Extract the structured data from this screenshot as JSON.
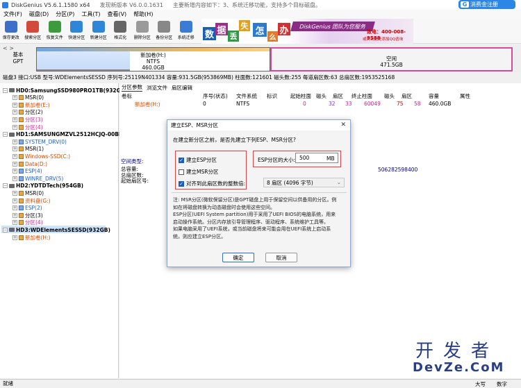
{
  "titlebar": {
    "app": "DiskGenius V5.6.1.1580 x64",
    "update": "发现新版本 V6.0.0.1631",
    "update_desc": "主要新增内容如下：3、系统迁移功能，支持多个目标磁盘。",
    "right_button": "消费金注册"
  },
  "menu": [
    "文件(F)",
    "磁盘(D)",
    "分区(P)",
    "工具(T)",
    "查看(V)",
    "帮助(H)"
  ],
  "toolbar": [
    {
      "label": "保存更改",
      "icon": "save-icon",
      "color": "#3c6fc7"
    },
    {
      "label": "搜索分区",
      "icon": "search-icon",
      "color": "#d44a3a"
    },
    {
      "label": "恢复文件",
      "icon": "recover-icon",
      "color": "#3c9b3c"
    },
    {
      "label": "快速分区",
      "icon": "quick-partition-icon",
      "color": "#2f85d8"
    },
    {
      "label": "新建分区",
      "icon": "new-partition-icon",
      "color": "#2f85d8"
    },
    {
      "label": "格式化",
      "icon": "format-icon",
      "color": "#666666"
    },
    {
      "label": "删除分区",
      "icon": "delete-icon",
      "color": "#9a9a9a"
    },
    {
      "label": "备份分区",
      "icon": "backup-icon",
      "color": "#888888"
    },
    {
      "label": "系统迁移",
      "icon": "migrate-icon",
      "color": "#3a7bd5"
    }
  ],
  "banner": {
    "chars": [
      "数",
      "据",
      "丢",
      "失",
      "怎",
      "么",
      "办"
    ],
    "slogan": "DiskGenius 团队为您服务",
    "phone": "致电：400-008-9588",
    "qq": "或点击此处添加QQ咨询"
  },
  "diskmap": {
    "nav": "< >",
    "label": [
      "基本",
      "GPT"
    ],
    "partition1": {
      "name": "新加卷(H:)",
      "fs": "NTFS",
      "size": "460.0GB",
      "used_fraction": 0.4
    },
    "partition2": {
      "name": "空闲",
      "size": "471.5GB"
    }
  },
  "diskinfo": "磁盘3 接口:USB 型号:WDElementsSESSD 序列号:25119N401334 容量:931.5GB(953869MB) 柱面数:121601 磁头数:255 每道扇区数:63 总扇区数:1953525168",
  "tree": [
    {
      "text": "HD0:SamsungSSD980PRO1TB(932GB)",
      "level": 0,
      "kind": "disk",
      "color": "#000",
      "bold": true
    },
    {
      "text": "MSR(0)",
      "level": 1,
      "kind": "part",
      "color": "#000"
    },
    {
      "text": "新加卷(E:)",
      "level": 1,
      "kind": "part",
      "color": "#d44a00"
    },
    {
      "text": "分区(2)",
      "level": 1,
      "kind": "part",
      "color": "#000"
    },
    {
      "text": "分区(3)",
      "level": 1,
      "kind": "part",
      "color": "#d6189a"
    },
    {
      "text": "分区(4)",
      "level": 1,
      "kind": "part",
      "color": "#d6189a"
    },
    {
      "text": "HD1:SAMSUNGMZVL2512HCJQ-00BL7",
      "level": 0,
      "kind": "disk",
      "color": "#000",
      "bold": true
    },
    {
      "text": "SYSTEM_DRV(0)",
      "level": 1,
      "kind": "part",
      "color": "#2060c8"
    },
    {
      "text": "MSR(1)",
      "level": 1,
      "kind": "part",
      "color": "#000"
    },
    {
      "text": "Windows-SSD(C:)",
      "level": 1,
      "kind": "part",
      "color": "#d44a00"
    },
    {
      "text": "Data(D:)",
      "level": 1,
      "kind": "part",
      "color": "#d44a00"
    },
    {
      "text": "ESP(4)",
      "level": 1,
      "kind": "part",
      "color": "#2060c8"
    },
    {
      "text": "WINRE_DRV(5)",
      "level": 1,
      "kind": "part",
      "color": "#2060c8"
    },
    {
      "text": "HD2:YDTDTech(954GB)",
      "level": 0,
      "kind": "disk",
      "color": "#000",
      "bold": true
    },
    {
      "text": "MSR(0)",
      "level": 1,
      "kind": "part",
      "color": "#000"
    },
    {
      "text": "资料盘(G:)",
      "level": 1,
      "kind": "part",
      "color": "#d44a00"
    },
    {
      "text": "ESP(2)",
      "level": 1,
      "kind": "part",
      "color": "#2060c8"
    },
    {
      "text": "分区(3)",
      "level": 1,
      "kind": "part",
      "color": "#000"
    },
    {
      "text": "分区(4)",
      "level": 1,
      "kind": "part",
      "color": "#d6189a"
    },
    {
      "text": "HD3:WDElementsSESSD(932GB)",
      "level": 0,
      "kind": "disk",
      "color": "#000",
      "bold": true,
      "selected": true
    },
    {
      "text": "新加卷(H:)",
      "level": 1,
      "kind": "part",
      "color": "#d44a00"
    }
  ],
  "right": {
    "tabs": [
      "分区参数",
      "浏览文件",
      "扇区编辑"
    ],
    "headers": [
      "卷标",
      "序号(状态)",
      "文件系统",
      "标识",
      "起始柱面",
      "磁头",
      "扇区",
      "终止柱面",
      "磁头",
      "扇区",
      "容量",
      "属性"
    ],
    "row": [
      "新加卷(H:)",
      "0",
      "NTFS",
      "",
      "0",
      "32",
      "33",
      "60049",
      "75",
      "58",
      "460.0GB",
      ""
    ],
    "ptype_label": "空间类型:",
    "props": [
      "总容量:",
      "总扇区数:",
      "起始扇区号:"
    ],
    "prop_value": "506282598400"
  },
  "dialog": {
    "title": "建立ESP、MSR分区",
    "close": "✕",
    "prompt": "在建立新分区之前，是否先建立下列ESP、MSR分区?",
    "cb_esp": "建立ESP分区",
    "cb_esp_checked": true,
    "cb_msr": "建立MSR分区",
    "cb_msr_checked": false,
    "cb_align": "对齐到此扇区数的整数倍:",
    "cb_align_checked": true,
    "esp_label": "ESP分区的大小:",
    "esp_value": "500",
    "esp_unit": "MB",
    "align_select": "8 扇区 (4096 字节)",
    "note": [
      "注: MSR分区(微软保留分区)是GPT磁盘上用于保留空间以供备用的分区。例",
      "如在将磁盘转换为动态磁盘时会使用这些空间。",
      "    ESP分区(UEFI System partition)用于采用了UEFI BIOS的电脑系统，用来",
      "启动操作系统。分区内存放引导管理程序、驱动程序、系统维护工具等。",
      "    如果电脑采用了UEFI系统，或当前磁盘将来可能会用在UEFI系统上启动系",
      "统，则应建立ESP分区。"
    ],
    "ok": "确定",
    "cancel": "取消"
  },
  "statusbar": {
    "left": "就绪",
    "caps": "大写",
    "num": "数字"
  },
  "watermark": {
    "cn": "开发者",
    "en": "DevZe.CoM"
  }
}
